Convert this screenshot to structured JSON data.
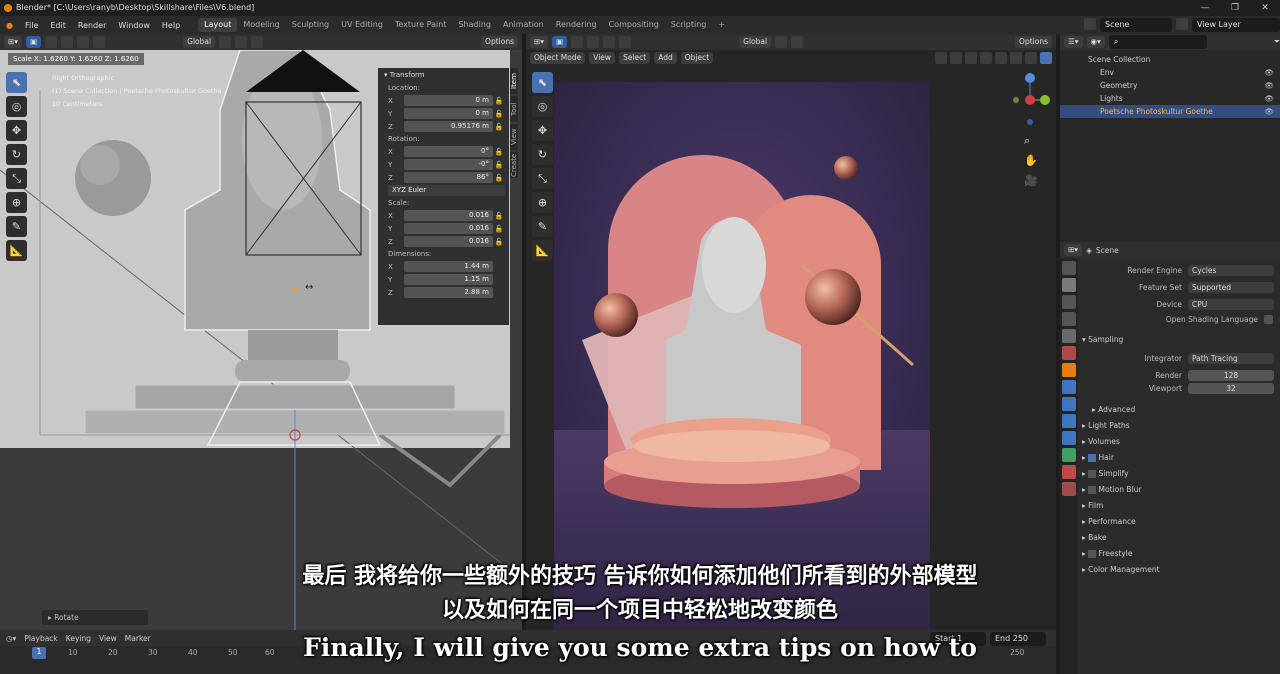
{
  "window": {
    "title": "Blender* [C:\\Users\\ranyb\\Desktop\\Skillshare\\Files\\V6.blend]",
    "controls": [
      "—",
      "❐",
      "✕"
    ]
  },
  "menu": [
    "File",
    "Edit",
    "Render",
    "Window",
    "Help"
  ],
  "workspaces": [
    "Layout",
    "Modeling",
    "Sculpting",
    "UV Editing",
    "Texture Paint",
    "Shading",
    "Animation",
    "Rendering",
    "Compositing",
    "Scripting",
    "+"
  ],
  "scene_field": "Scene",
  "view_layer_field": "View Layer",
  "left_viewport": {
    "orientation": "Global",
    "options": "Options",
    "scale_readout": "Scale X: 1.6260   Y: 1.6260   Z: 1.6260",
    "overlay": [
      "Right Orthographic",
      "(1) Scene Collection | Poetsche Photoskultur Goethe",
      "10 Centimeters"
    ],
    "rotate_label": "Rotate"
  },
  "transform": {
    "title": "Transform",
    "location_label": "Location:",
    "location": [
      {
        "a": "X",
        "v": "0 m"
      },
      {
        "a": "Y",
        "v": "0 m"
      },
      {
        "a": "Z",
        "v": "0.95176 m"
      }
    ],
    "rotation_label": "Rotation:",
    "rotation": [
      {
        "a": "X",
        "v": "0°"
      },
      {
        "a": "Y",
        "v": "-0°"
      },
      {
        "a": "Z",
        "v": "86°"
      }
    ],
    "rotation_mode": "XYZ Euler",
    "scale_label": "Scale:",
    "scale": [
      {
        "a": "X",
        "v": "0.016"
      },
      {
        "a": "Y",
        "v": "0.016"
      },
      {
        "a": "Z",
        "v": "0.016"
      }
    ],
    "dimensions_label": "Dimensions:",
    "dimensions": [
      {
        "a": "X",
        "v": "1.44 m"
      },
      {
        "a": "Y",
        "v": "1.15 m"
      },
      {
        "a": "Z",
        "v": "2.88 m"
      }
    ]
  },
  "side_tabs": [
    "Item",
    "Tool",
    "View",
    "Create"
  ],
  "right_viewport": {
    "orientation": "Global",
    "options": "Options",
    "mode": "Object Mode",
    "menus": [
      "View",
      "Select",
      "Add",
      "Object"
    ]
  },
  "outliner": {
    "root": "Scene Collection",
    "items": [
      "Env",
      "Geometry",
      "Lights",
      "Poetsche Photoskultur Goethe"
    ]
  },
  "properties": {
    "context": "Scene",
    "render_engine_label": "Render Engine",
    "render_engine": "Cycles",
    "feature_set_label": "Feature Set",
    "feature_set": "Supported",
    "device_label": "Device",
    "device": "CPU",
    "osl_label": "Open Shading Language",
    "sampling": "Sampling",
    "integrator_label": "Integrator",
    "integrator": "Path Tracing",
    "render_label": "Render",
    "render_samples": "128",
    "viewport_label": "Viewport",
    "viewport_samples": "32",
    "advanced": "Advanced",
    "panels": [
      "Light Paths",
      "Volumes",
      "Hair",
      "Simplify",
      "Motion Blur",
      "Film",
      "Performance",
      "Bake",
      "Freestyle",
      "Color Management"
    ]
  },
  "timeline": {
    "menus": [
      "Playback",
      "Keying",
      "View",
      "Marker"
    ],
    "frames": [
      "1",
      "10",
      "20",
      "30",
      "40",
      "50",
      "60",
      "250"
    ],
    "start_label": "Start",
    "start": "1",
    "end_label": "End",
    "end": "250"
  },
  "subtitles": {
    "zh1": "最后 我将给你一些额外的技巧 告诉你如何添加他们所看到的外部模型",
    "zh2": "以及如何在同一个项目中轻松地改变颜色",
    "en": "Finally, I will give you some extra tips on how to"
  },
  "colors": {
    "accent": "#4a72b0",
    "selected": "#334d80",
    "orange": "#e87d0d",
    "pink": "#d98585"
  }
}
